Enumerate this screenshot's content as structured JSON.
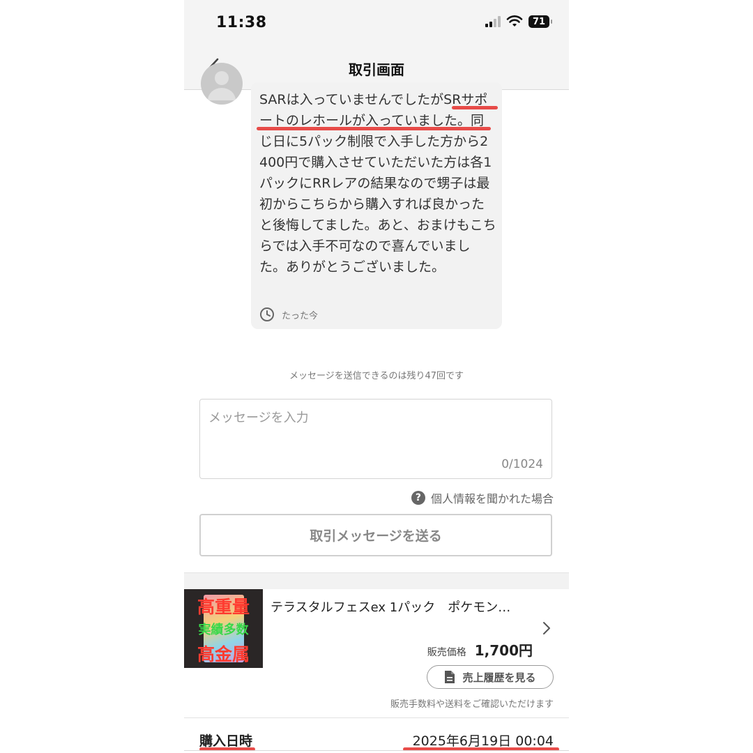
{
  "status_bar": {
    "time": "11:38",
    "battery": "71"
  },
  "nav": {
    "title": "取引画面"
  },
  "message": {
    "text": "SARは入っていませんでしたがSRサポートのレホールが入っていました。同じ日に5パック制限で入手した方から2400円で購入させていただいた方は各1パックにRRレアの結果なので甥子は最初からこちらから購入すれば良かったと後悔してました。あと、おまけもこちらでは入手不可なので喜んでいました。ありがとうございました。",
    "time": "たった今"
  },
  "remaining_notice": "メッセージを送信できるのは残り47回です",
  "compose": {
    "placeholder": "メッセージを入力",
    "counter": "0/1024"
  },
  "privacy_link": "個人情報を聞かれた場合",
  "send_button": "取引メッセージを送る",
  "product": {
    "name": "テラスタルフェスex 1パック　ポケモン…",
    "thumb_text": {
      "line1": "高重量",
      "line2": "実績多数",
      "line3": "高金属"
    },
    "price_label": "販売価格",
    "price": "1,700円",
    "history_button": "売上履歴を見る",
    "fee_note": "販売手数料や送料をご確認いただけます"
  },
  "purchase": {
    "label": "購入日時",
    "value": "2025年6月19日 00:04"
  },
  "colors": {
    "annotation_red": "#e53935",
    "price_text": "#222222"
  }
}
